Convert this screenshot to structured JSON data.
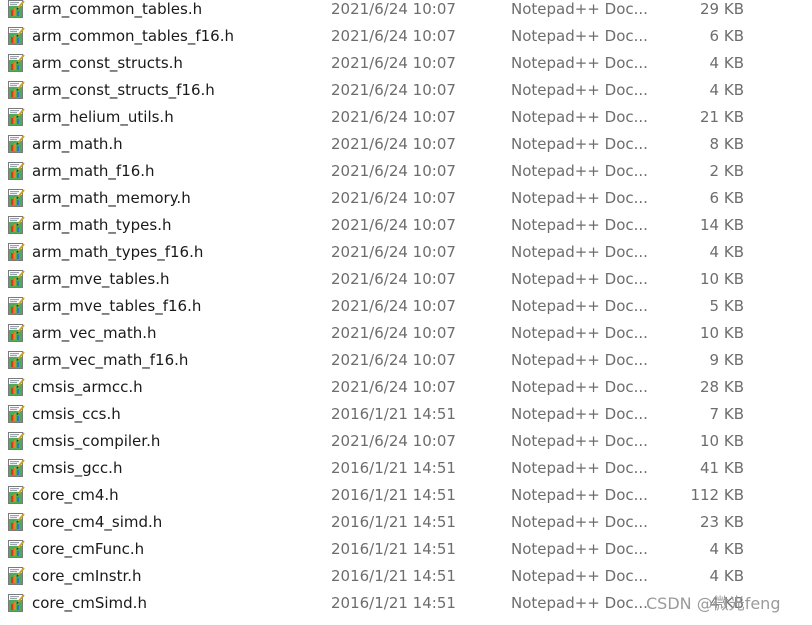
{
  "file_list": {
    "icon_name": "notepadpp-header-file-icon",
    "rows": [
      {
        "name": "arm_common_tables.h",
        "date": "2021/6/24 10:07",
        "type": "Notepad++ Doc...",
        "size": "29 KB"
      },
      {
        "name": "arm_common_tables_f16.h",
        "date": "2021/6/24 10:07",
        "type": "Notepad++ Doc...",
        "size": "6 KB"
      },
      {
        "name": "arm_const_structs.h",
        "date": "2021/6/24 10:07",
        "type": "Notepad++ Doc...",
        "size": "4 KB"
      },
      {
        "name": "arm_const_structs_f16.h",
        "date": "2021/6/24 10:07",
        "type": "Notepad++ Doc...",
        "size": "4 KB"
      },
      {
        "name": "arm_helium_utils.h",
        "date": "2021/6/24 10:07",
        "type": "Notepad++ Doc...",
        "size": "21 KB"
      },
      {
        "name": "arm_math.h",
        "date": "2021/6/24 10:07",
        "type": "Notepad++ Doc...",
        "size": "8 KB"
      },
      {
        "name": "arm_math_f16.h",
        "date": "2021/6/24 10:07",
        "type": "Notepad++ Doc...",
        "size": "2 KB"
      },
      {
        "name": "arm_math_memory.h",
        "date": "2021/6/24 10:07",
        "type": "Notepad++ Doc...",
        "size": "6 KB"
      },
      {
        "name": "arm_math_types.h",
        "date": "2021/6/24 10:07",
        "type": "Notepad++ Doc...",
        "size": "14 KB"
      },
      {
        "name": "arm_math_types_f16.h",
        "date": "2021/6/24 10:07",
        "type": "Notepad++ Doc...",
        "size": "4 KB"
      },
      {
        "name": "arm_mve_tables.h",
        "date": "2021/6/24 10:07",
        "type": "Notepad++ Doc...",
        "size": "10 KB"
      },
      {
        "name": "arm_mve_tables_f16.h",
        "date": "2021/6/24 10:07",
        "type": "Notepad++ Doc...",
        "size": "5 KB"
      },
      {
        "name": "arm_vec_math.h",
        "date": "2021/6/24 10:07",
        "type": "Notepad++ Doc...",
        "size": "10 KB"
      },
      {
        "name": "arm_vec_math_f16.h",
        "date": "2021/6/24 10:07",
        "type": "Notepad++ Doc...",
        "size": "9 KB"
      },
      {
        "name": "cmsis_armcc.h",
        "date": "2021/6/24 10:07",
        "type": "Notepad++ Doc...",
        "size": "28 KB"
      },
      {
        "name": "cmsis_ccs.h",
        "date": "2016/1/21 14:51",
        "type": "Notepad++ Doc...",
        "size": "7 KB"
      },
      {
        "name": "cmsis_compiler.h",
        "date": "2021/6/24 10:07",
        "type": "Notepad++ Doc...",
        "size": "10 KB"
      },
      {
        "name": "cmsis_gcc.h",
        "date": "2016/1/21 14:51",
        "type": "Notepad++ Doc...",
        "size": "41 KB"
      },
      {
        "name": "core_cm4.h",
        "date": "2016/1/21 14:51",
        "type": "Notepad++ Doc...",
        "size": "112 KB"
      },
      {
        "name": "core_cm4_simd.h",
        "date": "2016/1/21 14:51",
        "type": "Notepad++ Doc...",
        "size": "23 KB"
      },
      {
        "name": "core_cmFunc.h",
        "date": "2016/1/21 14:51",
        "type": "Notepad++ Doc...",
        "size": "4 KB"
      },
      {
        "name": "core_cmInstr.h",
        "date": "2016/1/21 14:51",
        "type": "Notepad++ Doc...",
        "size": "4 KB"
      },
      {
        "name": "core_cmSimd.h",
        "date": "2016/1/21 14:51",
        "type": "Notepad++ Doc...",
        "size": "4 KB"
      }
    ]
  },
  "watermark": {
    "text": "CSDN @微光feng"
  },
  "colors": {
    "name_text": "#1a1a1a",
    "detail_text": "#6d6d6d",
    "icon_green": "#2f9e3b",
    "icon_bar_red": "#d33a2c",
    "icon_bar_orange": "#e08a1e",
    "icon_bar_blue": "#3a6fcf"
  }
}
